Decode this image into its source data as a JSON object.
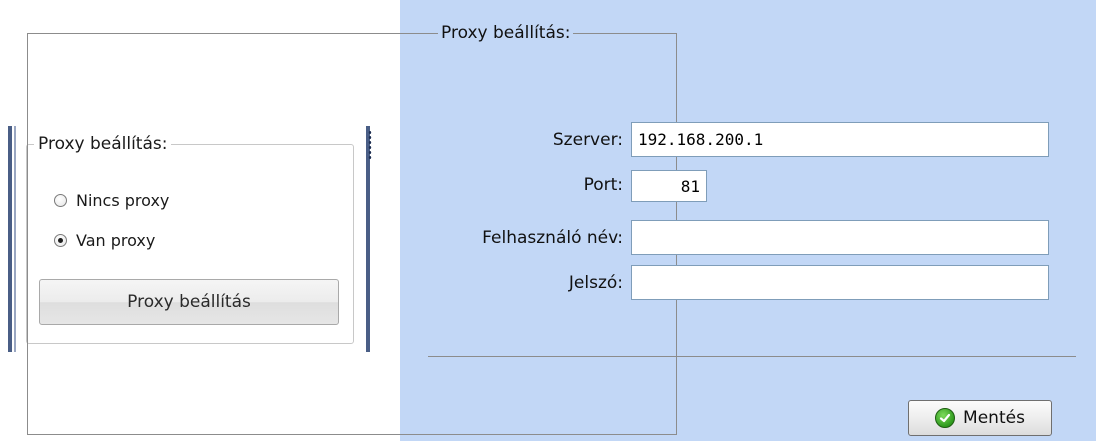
{
  "left_panel": {
    "group_title": "Proxy beállítás:",
    "radios": [
      {
        "label": "Nincs proxy",
        "checked": false
      },
      {
        "label": "Van proxy",
        "checked": true
      }
    ],
    "button_label": "Proxy beállítás"
  },
  "right_panel": {
    "group_title": "Proxy beállítás:",
    "fields": {
      "server": {
        "label": "Szerver:",
        "value": "192.168.200.1"
      },
      "port": {
        "label": "Port:",
        "value": "81"
      },
      "username": {
        "label": "Felhasználó név:",
        "value": ""
      },
      "password": {
        "label": "Jelszó:",
        "value": ""
      }
    },
    "save_label": "Mentés",
    "save_icon": "check-circle-icon"
  },
  "colors": {
    "panel_background": "#c2d7f6",
    "accent_bar": "#4a5e86",
    "save_icon_green": "#2f9a1e"
  }
}
